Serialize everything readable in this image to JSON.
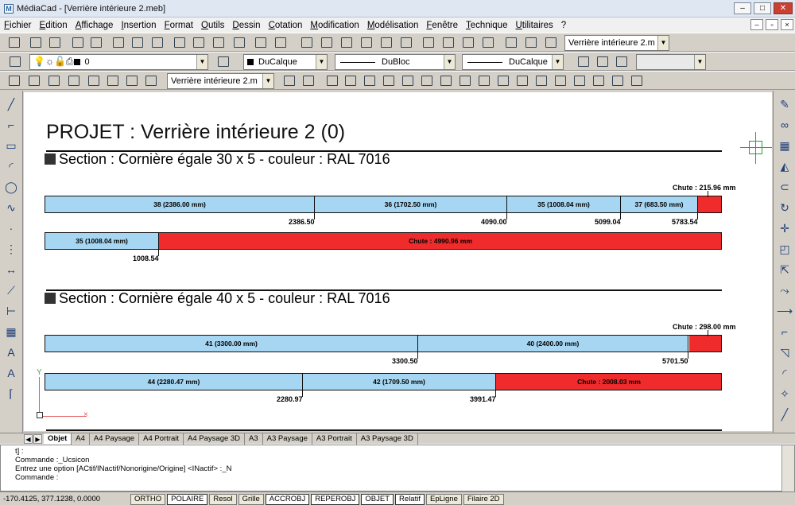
{
  "titlebar": {
    "title": "MédiaCad - [Verrière intérieure 2.meb]",
    "app_icon": "M",
    "minimize": "–",
    "restore": "□",
    "close": "✕"
  },
  "menubar": {
    "items": [
      "Fichier",
      "Edition",
      "Affichage",
      "Insertion",
      "Format",
      "Outils",
      "Dessin",
      "Cotation",
      "Modification",
      "Modélisation",
      "Fenêtre",
      "Technique",
      "Utilitaires",
      "?"
    ],
    "mdi": [
      "–",
      "▫",
      "×"
    ]
  },
  "toolbar1": {
    "view_select": "Verrière intérieure 2.m"
  },
  "toolbar2": {
    "layer_select": "0",
    "color_select": "DuCalque",
    "linetype_select": "DuBloc",
    "lineweight_select": "DuCalque"
  },
  "toolbar3": {
    "view_select": "Verrière intérieure 2.m"
  },
  "icons": {
    "layer": "layers-icon",
    "on": "lightbulb-icon",
    "sun": "sun-icon",
    "lock": "lock-icon"
  },
  "drawing": {
    "title": "PROJET : Verrière intérieure 2 (0)",
    "sections": [
      {
        "title": "Section : Cornière égale 30 x 5 - couleur : RAL 7016",
        "bars": [
          {
            "segments": [
              {
                "label": "38 (2386.00 mm)",
                "length": 2386.0,
                "color": "blue"
              },
              {
                "label": "36 (1702.50 mm)",
                "length": 1702.5,
                "color": "blue"
              },
              {
                "label": "35 (1008.04 mm)",
                "length": 1008.04,
                "color": "blue"
              },
              {
                "label": "37 (683.50 mm)",
                "length": 683.5,
                "color": "blue"
              },
              {
                "label": "",
                "length": 215.96,
                "color": "red"
              }
            ],
            "marks": [
              "2386.50",
              "4090.00",
              "5099.04",
              "5783.54"
            ],
            "chute_label": "Chute : 215.96 mm"
          },
          {
            "segments": [
              {
                "label": "35 (1008.04 mm)",
                "length": 1008.04,
                "color": "blue"
              },
              {
                "label": "Chute : 4990.96 mm",
                "length": 4990.96,
                "color": "red"
              }
            ],
            "marks": [
              "1008.54"
            ],
            "chute_label": ""
          }
        ]
      },
      {
        "title": "Section : Cornière égale 40 x 5 - couleur : RAL 7016",
        "bars": [
          {
            "segments": [
              {
                "label": "41 (3300.00 mm)",
                "length": 3300.0,
                "color": "blue"
              },
              {
                "label": "40 (2400.00 mm)",
                "length": 2400.0,
                "color": "blue"
              },
              {
                "label": "",
                "length": 298.0,
                "color": "red"
              }
            ],
            "marks": [
              "3300.50",
              "5701.50"
            ],
            "chute_label": "Chute : 298.00 mm"
          },
          {
            "segments": [
              {
                "label": "44 (2280.47 mm)",
                "length": 2280.47,
                "color": "blue"
              },
              {
                "label": "42 (1709.50 mm)",
                "length": 1709.5,
                "color": "blue"
              },
              {
                "label": "Chute : 2008.03 mm",
                "length": 2008.03,
                "color": "red"
              }
            ],
            "marks": [
              "2280.97",
              "3991.47"
            ],
            "chute_label": ""
          }
        ]
      }
    ],
    "ucs": {
      "x": "×",
      "y": "Y"
    },
    "colors": {
      "blue": "#a6d6f2",
      "red": "#f02b2b",
      "rule": "#111111"
    }
  },
  "layout_tabs": {
    "nav": [
      "◀",
      "▶"
    ],
    "items": [
      "Objet",
      "A4",
      "A4 Paysage",
      "A4 Portrait",
      "A4 Paysage 3D",
      "A3",
      "A3 Paysage",
      "A3 Portrait",
      "A3 Paysage 3D"
    ],
    "active": "Objet"
  },
  "command": {
    "lines": [
      "t] :",
      "Commande :_Ucsicon",
      "Entrez une option [ACtif/INactif/Nonorigine/Origine] <INactif> :_N",
      "Commande :"
    ]
  },
  "status": {
    "coords": "-170.4125, 377.1238, 0.0000",
    "buttons": [
      {
        "label": "ORTHO",
        "active": false
      },
      {
        "label": "POLAIRE",
        "active": true
      },
      {
        "label": "Resol",
        "active": false
      },
      {
        "label": "Grille",
        "active": false
      },
      {
        "label": "ACCROBJ",
        "active": true
      },
      {
        "label": "REPEROBJ",
        "active": true
      },
      {
        "label": "OBJET",
        "active": true
      },
      {
        "label": "Relatif",
        "active": true
      },
      {
        "label": "EpLigne",
        "active": false
      },
      {
        "label": "Filaire 2D",
        "active": false
      }
    ]
  }
}
